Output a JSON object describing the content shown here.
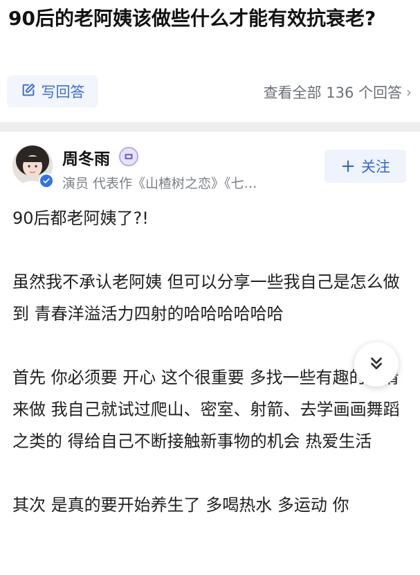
{
  "question": {
    "title": "90后的老阿姨该做些什么才能有效抗衰老?"
  },
  "actions": {
    "write_answer_label": "写回答",
    "view_all_label": "查看全部 136 个回答"
  },
  "author": {
    "name": "周冬雨",
    "bio": "演员 代表作《山楂树之恋》《七…",
    "follow_label": "关注"
  },
  "answer": {
    "paragraphs": [
      "90后都老阿姨了?!",
      "虽然我不承认老阿姨 但可以分享一些我自己是怎么做到 青春洋溢活力四射的哈哈哈哈哈哈",
      "首先 你必须要 开心 这个很重要 多找一些有趣的事情来做 我自己就试过爬山、密室、射箭、去学画画舞蹈之类的 得给自己不断接触新事物的机会 热爱生活",
      "其次 是真的要开始养生了 多喝热水 多运动 你"
    ]
  },
  "colors": {
    "accent": "#2f68d8",
    "divider": "#eeeeee",
    "muted_text": "#7a7e84"
  }
}
